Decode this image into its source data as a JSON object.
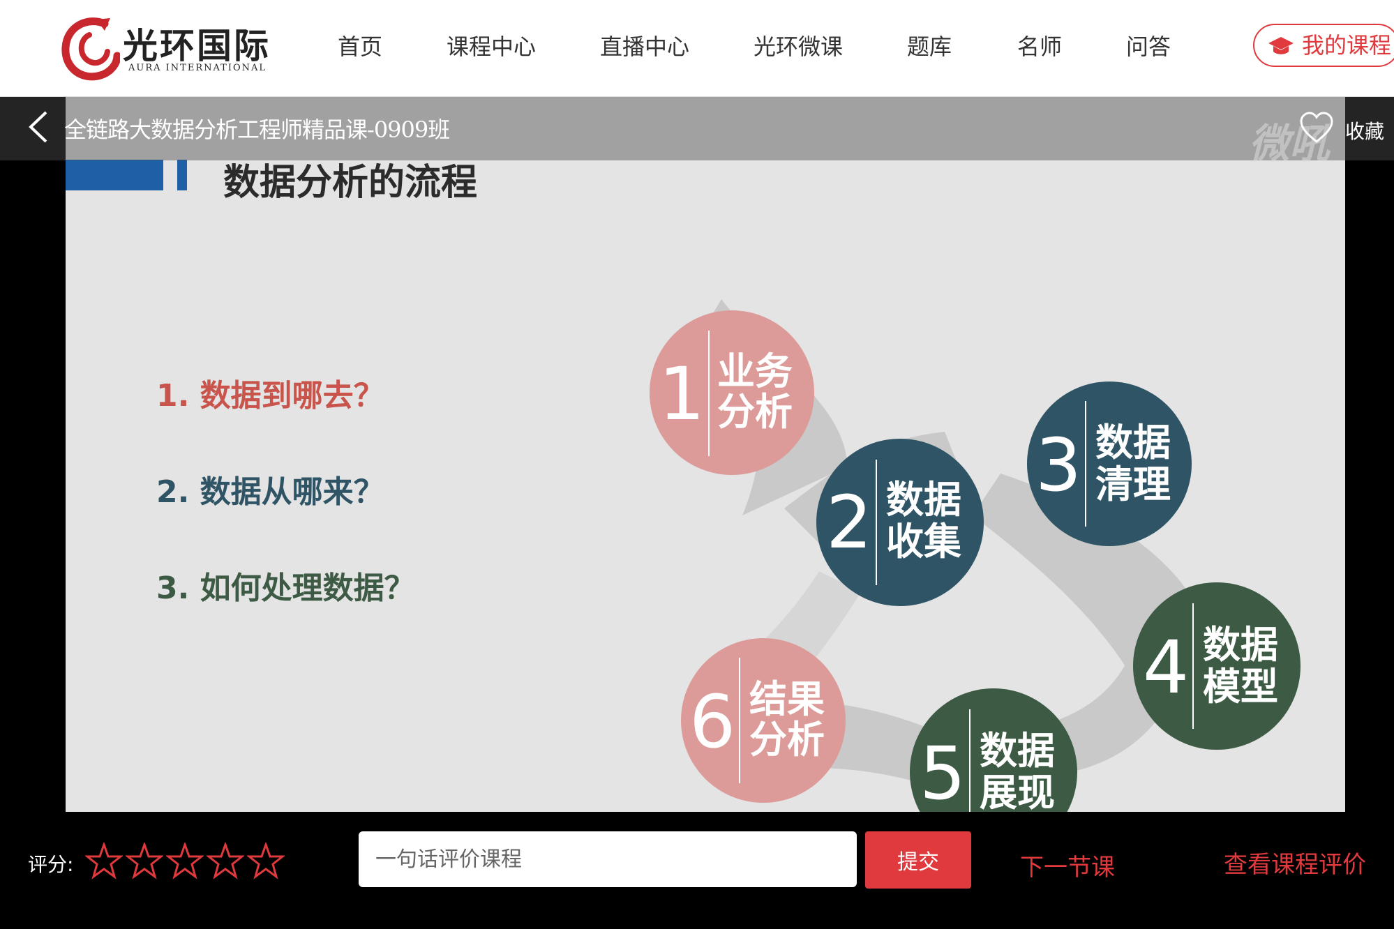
{
  "header": {
    "logo_cn": "光环国际",
    "logo_en": "AURA INTERNATIONAL",
    "nav": [
      "首页",
      "课程中心",
      "直播中心",
      "光环微课",
      "题库",
      "名师",
      "问答"
    ],
    "my_course": "我的课程",
    "accent_color": "#e03a3e"
  },
  "player": {
    "title": "全链路大数据分析工程师精品课-0909班",
    "watermark": "微吼",
    "favorite": "收藏"
  },
  "slide": {
    "title": "数据分析的流程",
    "questions": [
      "1.  数据到哪去？",
      "2.  数据从哪来？",
      "3.  如何处理数据？"
    ],
    "steps": [
      {
        "num": "1",
        "line1": "业务",
        "line2": "分析",
        "color": "#dc9b98"
      },
      {
        "num": "2",
        "line1": "数据",
        "line2": "收集",
        "color": "#2e5465"
      },
      {
        "num": "3",
        "line1": "数据",
        "line2": "清理",
        "color": "#2e5465"
      },
      {
        "num": "4",
        "line1": "数据",
        "line2": "模型",
        "color": "#3d5b44"
      },
      {
        "num": "5",
        "line1": "数据",
        "line2": "展现",
        "color": "#3d5b44"
      },
      {
        "num": "6",
        "line1": "结果",
        "line2": "分析",
        "color": "#dc9b98"
      }
    ]
  },
  "feedback": {
    "rating_label": "评分:",
    "star_count": 5,
    "comment_placeholder": "一句话评价课程",
    "submit": "提交",
    "next_lesson": "下一节课",
    "view_reviews": "查看课程评价"
  }
}
